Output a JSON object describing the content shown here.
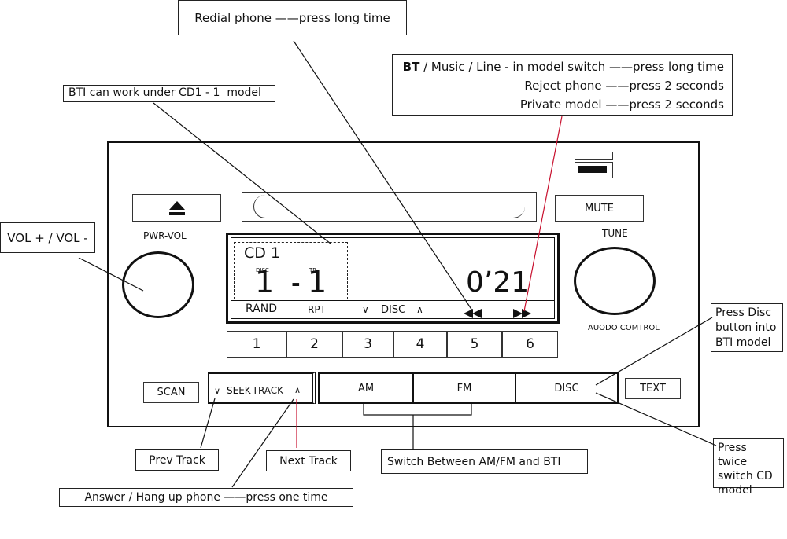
{
  "callouts": {
    "redial": {
      "action": "Redial phone",
      "dash": "——",
      "how": "press long time"
    },
    "bt_box": {
      "rows": [
        {
          "action": "BT / Music / Line - in model switch",
          "dash": "——",
          "how": "press long time"
        },
        {
          "action": "Reject phone",
          "dash": "——",
          "how": "press 2 seconds"
        },
        {
          "action": "Private model",
          "dash": "——",
          "how": "press 2 seconds"
        }
      ]
    },
    "bti_cd": "BTI can work under CD1 - 1  model",
    "vol": "VOL + / VOL -",
    "press_disc": [
      "Press Disc",
      "button into",
      "BTI model"
    ],
    "press_twice": [
      "Press twice",
      "switch CD",
      "model"
    ],
    "prev_track": "Prev Track",
    "next_track": "Next Track",
    "switch_am_fm": "Switch Between AM/FM and BTI",
    "answer": {
      "action": "Answer / Hang up phone",
      "dash": "——",
      "how": "press one time"
    }
  },
  "radio": {
    "eject_icon": "eject-icon",
    "pwr_vol_label": "PWR-VOL",
    "mute_label": "MUTE",
    "tune_label": "TUNE",
    "audio_control_label": "AUODO COMTROL",
    "display": {
      "source": "CD 1",
      "disc_label": "DISC",
      "tr_label": "TR",
      "disc_value": "1",
      "separator": "-",
      "track_value": "1",
      "time": "0’21",
      "rand": "RAND",
      "rpt": "RPT",
      "disc_down": "∨",
      "disc": "DISC",
      "disc_up": "∧",
      "rewind_icon": "rewind-icon",
      "forward_icon": "fast-forward-icon"
    },
    "presets": [
      "1",
      "2",
      "3",
      "4",
      "5",
      "6"
    ],
    "scan_label": "SCAN",
    "seek_down": "∨",
    "seek_label": "SEEK-TRACK",
    "seek_up": "∧",
    "am_label": "AM",
    "fm_label": "FM",
    "disc_label": "DISC",
    "text_label": "TEXT"
  },
  "colors": {
    "line": "#111111",
    "accent_red": "#c8102e"
  }
}
